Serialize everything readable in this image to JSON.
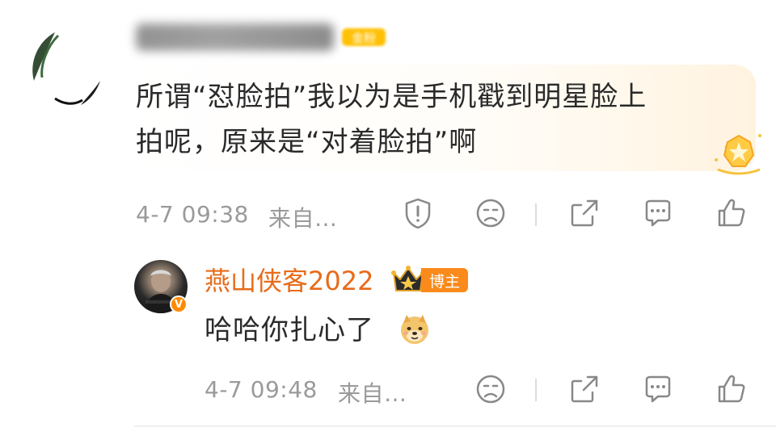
{
  "comment": {
    "author_badge": "金粉",
    "text_line1": "所谓“怼脸拍”我以为是手机戳到明星脸上",
    "text_line2": "拍呢，原来是“对着脸拍”啊",
    "timestamp": "4-7 09:38",
    "source": "来自…",
    "actions": [
      "report-icon",
      "dislike-icon",
      "share-icon",
      "reply-icon",
      "like-icon"
    ]
  },
  "reply": {
    "author": "燕山侠客2022",
    "role_badge": "博主",
    "verified_mark": "V",
    "text": "哈哈你扎心了",
    "emoji": "doge-emoji",
    "timestamp": "4-7 09:48",
    "source": "来自…",
    "actions": [
      "dislike-icon",
      "share-icon",
      "reply-icon",
      "like-icon"
    ]
  },
  "colors": {
    "author_name": "#e86b1a",
    "host_badge": "#f98a1b",
    "meta_text": "#9a9a9a",
    "body_text": "#2a2a2a",
    "fan_badge": "#ffc107"
  }
}
